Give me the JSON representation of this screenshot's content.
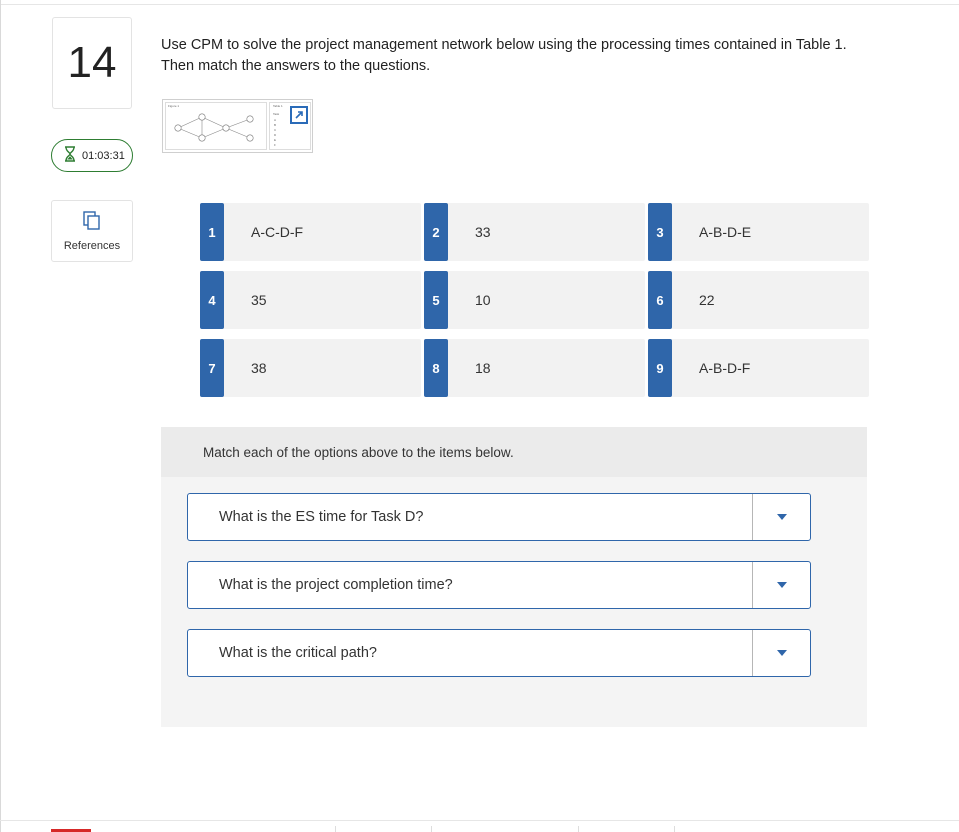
{
  "question": {
    "number": "14",
    "prompt": "Use CPM to solve the project management network below using the processing times contained in Table 1. Then match the answers to the questions."
  },
  "timer": {
    "value": "01:03:31",
    "color": "#2e7d32"
  },
  "references": {
    "label": "References"
  },
  "thumbnail": {
    "figure_label": "Figure 1",
    "table_label": "Table 1",
    "table_header": "Task",
    "tasks": [
      "A",
      "B",
      "C",
      "D",
      "E",
      "F"
    ]
  },
  "options": [
    {
      "num": "1",
      "value": "A-C-D-F"
    },
    {
      "num": "2",
      "value": "33"
    },
    {
      "num": "3",
      "value": "A-B-D-E"
    },
    {
      "num": "4",
      "value": "35"
    },
    {
      "num": "5",
      "value": "10"
    },
    {
      "num": "6",
      "value": "22"
    },
    {
      "num": "7",
      "value": "38"
    },
    {
      "num": "8",
      "value": "18"
    },
    {
      "num": "9",
      "value": "A-B-D-F"
    }
  ],
  "match": {
    "instruction": "Match each of the options above to the items below.",
    "items": [
      {
        "question": "What is the ES time for Task D?"
      },
      {
        "question": "What is the project completion time?"
      },
      {
        "question": "What is the critical path?"
      }
    ]
  },
  "colors": {
    "accent": "#2f66aa",
    "card_bg": "#f2f2f2",
    "panel_bg": "#f4f4f4",
    "bottom_marker": "#d62828"
  }
}
